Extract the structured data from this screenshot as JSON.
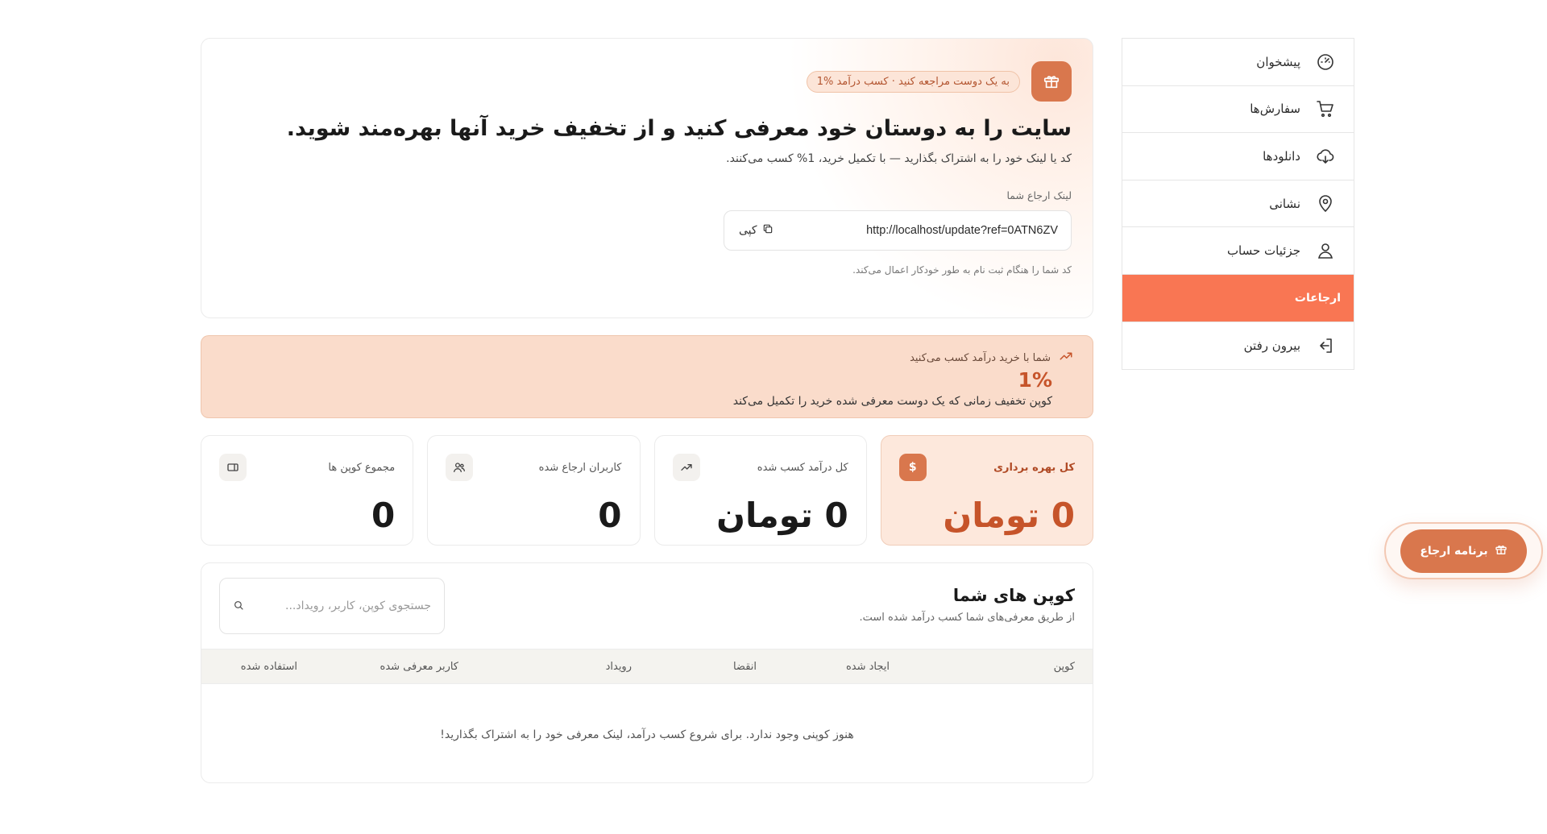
{
  "sidebar": {
    "items": [
      {
        "label": "پیشخوان",
        "icon": "speedometer-icon"
      },
      {
        "label": "سفارش‌ها",
        "icon": "cart-icon"
      },
      {
        "label": "دانلودها",
        "icon": "cloud-download-icon"
      },
      {
        "label": "نشانی",
        "icon": "location-pin-icon"
      },
      {
        "label": "جزئیات حساب",
        "icon": "user-icon"
      },
      {
        "label": "ارجاعات",
        "icon": "",
        "active": true
      },
      {
        "label": "بیرون رفتن",
        "icon": "logout-icon"
      }
    ]
  },
  "hero": {
    "pill": "به یک دوست مراجعه کنید · کسب درآمد %1",
    "title": "سایت را به دوستان خود معرفی کنید و از تخفیف خرید آنها بهره‌مند شوید.",
    "subtitle": "کد یا لینک خود را به اشتراک بگذارید — با تکمیل خرید، 1% کسب می‌کنند.",
    "ref_label": "لینک ارجاع شما",
    "ref_url": "http://localhost/update?ref=0ATN6ZV",
    "copy_label": "کپی",
    "ref_note": "کد شما را هنگام ثبت نام به طور خودکار اعمال می‌کند."
  },
  "earn": {
    "label": "شما با خرید درآمد کسب می‌کنید",
    "percent": "1%",
    "description": "کوپن تخفیف زمانی که یک دوست معرفی شده خرید را تکمیل می‌کند"
  },
  "stats": [
    {
      "label": "کل بهره برداری",
      "value": "0 تومان",
      "icon": "dollar-icon"
    },
    {
      "label": "کل درآمد کسب شده",
      "value": "0 تومان",
      "icon": "trend-up-icon"
    },
    {
      "label": "کاربران ارجاع شده",
      "value": "0",
      "icon": "users-icon"
    },
    {
      "label": "مجموع کوپن ها",
      "value": "0",
      "icon": "ticket-icon"
    }
  ],
  "coupons": {
    "title": "کوپن های شما",
    "subtitle": "از طریق معرفی‌های شما کسب درآمد شده است.",
    "search_placeholder": "جستجوی کوپن، کاربر، رویداد...",
    "columns": [
      "کوپن",
      "ایجاد شده",
      "انقضا",
      "رویداد",
      "کاربر معرفی شده",
      "استفاده شده"
    ],
    "empty": "هنوز کوپنی وجود ندارد. برای شروع کسب درآمد، لینک معرفی خود را به اشتراک بگذارید!"
  },
  "fab": {
    "label": "برنامه ارجاع"
  },
  "colors": {
    "accent": "#d9774d",
    "active_nav": "#f97653",
    "banner": "#fadccb",
    "accent_text": "#c6542a"
  }
}
